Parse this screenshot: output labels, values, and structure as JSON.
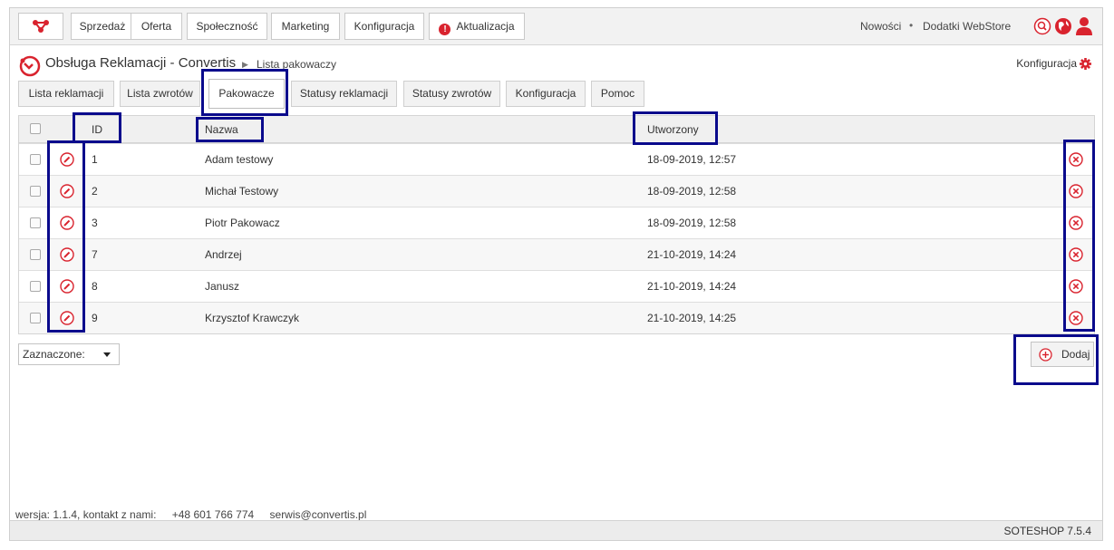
{
  "nav": {
    "items": [
      {
        "label": "Sprzedaż"
      },
      {
        "label": "Oferta"
      },
      {
        "label": "Społeczność"
      },
      {
        "label": "Marketing"
      },
      {
        "label": "Konfiguracja"
      },
      {
        "label": "Aktualizacja"
      }
    ],
    "alert_glyph": "!",
    "news_label": "Nowości",
    "separator": "•",
    "webstore_label": "Dodatki WebStore"
  },
  "header": {
    "title": "Obsługa Reklamacji - Convertis",
    "breadcrumb_arrow": "▶",
    "breadcrumb": "Lista pakowaczy",
    "config_link": "Konfiguracja"
  },
  "tabs": [
    {
      "label": "Lista reklamacji"
    },
    {
      "label": "Lista zwrotów"
    },
    {
      "label": "Pakowacze",
      "active": true
    },
    {
      "label": "Statusy reklamacji"
    },
    {
      "label": "Statusy zwrotów"
    },
    {
      "label": "Konfiguracja"
    },
    {
      "label": "Pomoc"
    }
  ],
  "table": {
    "columns": {
      "id": "ID",
      "name": "Nazwa",
      "created": "Utworzony"
    },
    "rows": [
      {
        "id": "1",
        "name": "Adam testowy",
        "created": "18-09-2019, 12:57"
      },
      {
        "id": "2",
        "name": "Michał Testowy",
        "created": "18-09-2019, 12:58"
      },
      {
        "id": "3",
        "name": "Piotr Pakowacz",
        "created": "18-09-2019, 12:58"
      },
      {
        "id": "7",
        "name": "Andrzej",
        "created": "21-10-2019, 14:24"
      },
      {
        "id": "8",
        "name": "Janusz",
        "created": "21-10-2019, 14:24"
      },
      {
        "id": "9",
        "name": "Krzysztof Krawczyk",
        "created": "21-10-2019, 14:25"
      }
    ]
  },
  "bulk": {
    "selected_label": "Zaznaczone:"
  },
  "add_button": {
    "label": "Dodaj"
  },
  "footer": {
    "version_info": "wersja: 1.1.4, kontakt z nami:",
    "phone": "+48 601 766 774",
    "email": "serwis@convertis.pl",
    "shop_version": "SOTESHOP 7.5.4"
  },
  "colors": {
    "accent": "#d9232e",
    "highlight": "#0a0a8c"
  }
}
